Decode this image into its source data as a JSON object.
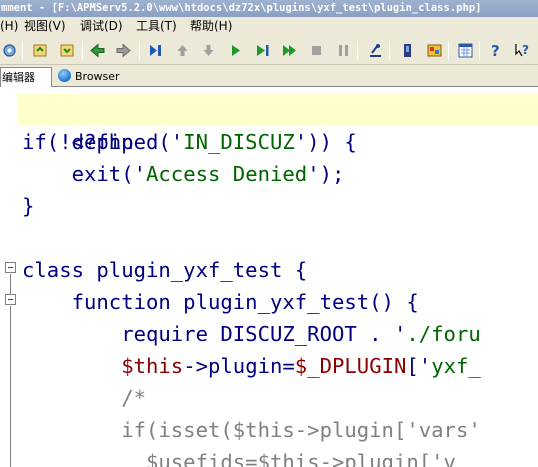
{
  "window": {
    "title": "mment - [F:\\APMServ5.2.0\\www\\htdocs\\dz72x\\plugins\\yxf_test\\plugin_class.php]"
  },
  "menubar": {
    "items": [
      "(H)",
      "视图(V)",
      "调试(D)",
      "工具(T)",
      "帮助(H)"
    ]
  },
  "toolbar": {
    "icons": [
      "gear-icon",
      "refresh-icon",
      "refresh-down-icon",
      "back-icon",
      "forward-icon",
      "step-into-icon",
      "up-arrow-icon",
      "down-arrow-icon",
      "run-icon",
      "run-to-icon",
      "fast-forward-icon",
      "stop-icon",
      "pause-icon",
      "inspect-icon",
      "bookmark-icon",
      "palette-icon",
      "calendar-icon",
      "help-icon",
      "context-help-icon"
    ]
  },
  "tabs": [
    {
      "label": "编辑器"
    },
    {
      "label": "Browser"
    }
  ],
  "editor": {
    "lines": [
      [
        "<?php"
      ],
      [
        "if(!defined('",
        "IN_DISCUZ",
        "')) {"
      ],
      [
        "    exit('",
        "Access Denied",
        "');"
      ],
      [
        "}"
      ],
      [
        ""
      ],
      [
        "class plugin_yxf_test {"
      ],
      [
        "    function plugin_yxf_test() {"
      ],
      [
        "        require DISCUZ_ROOT . '",
        "./foru"
      ],
      [
        "        ",
        "$this",
        "->plugin=",
        "$_DPLUGIN",
        "['",
        "yxf_"
      ],
      [
        "        /*"
      ],
      [
        "        if(isset($this->plugin['vars'"
      ],
      [
        "          $usefids=$this->plugin['v"
      ]
    ]
  },
  "colors": {
    "keyword": "#000080",
    "string": "#006400",
    "variable": "#8b0000",
    "comment": "#808080",
    "current_line": "#ffffcc"
  }
}
